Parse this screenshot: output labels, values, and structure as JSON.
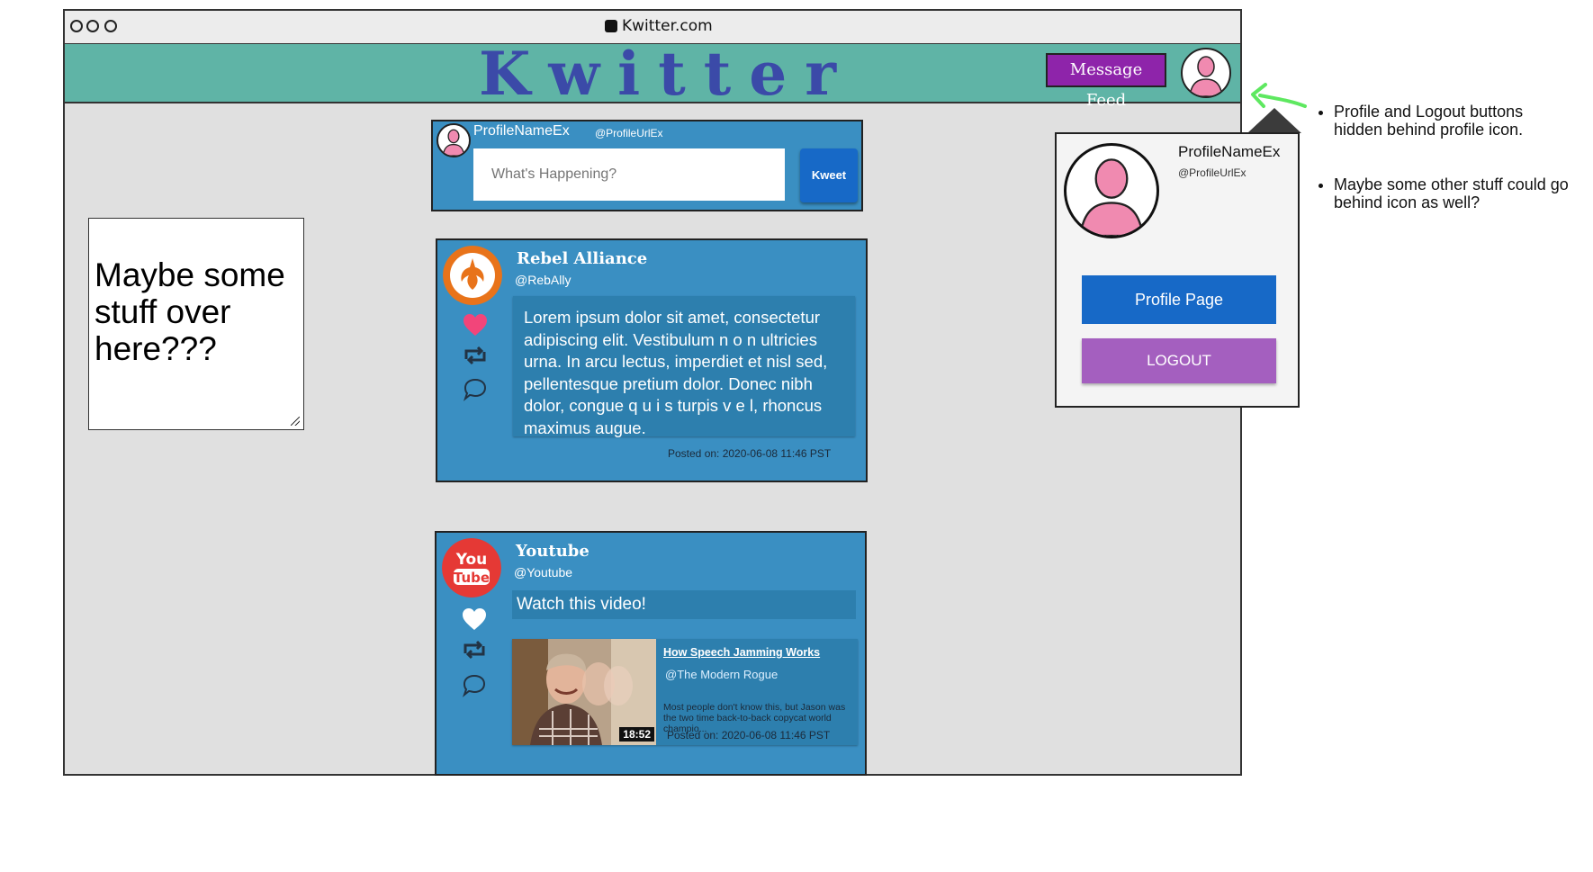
{
  "browser": {
    "url": "Kwitter.com"
  },
  "header": {
    "logo": "Kwitter",
    "message_feed_label": "Message Feed"
  },
  "compose": {
    "profile_name": "ProfileNameEx",
    "profile_url": "@ProfileUrlEx",
    "placeholder": "What's Happening?",
    "submit_label": "Kweet"
  },
  "side_note": {
    "text": "Maybe some stuff over here???"
  },
  "posts": [
    {
      "author": "Rebel Alliance",
      "handle": "@RebAlly",
      "body": "Lorem ipsum dolor sit amet, consectetur adipiscing elit. Vestibulum n o n ultricies urna. In arcu lectus, imperdiet et nisl sed, pellentesque pretium dolor. Donec nibh dolor, congue q u i s turpis v e l, rhoncus maximus augue.",
      "posted": "Posted on: 2020-06-08 11:46 PST",
      "liked": true
    },
    {
      "author": "Youtube",
      "handle": "@Youtube",
      "body": "Watch this video!",
      "posted": "Posted on: 2020-06-08 11:46 PST",
      "liked": false,
      "video": {
        "title": "How Speech Jamming Works",
        "channel": "@The Modern Rogue",
        "description": "Most people don't know this, but Jason was the two time back-to-back copycat world champio...",
        "duration": "18:52"
      },
      "logo_text_top": "You",
      "logo_text_bottom": "Tube"
    }
  ],
  "profile_dropdown": {
    "name": "ProfileNameEx",
    "url": "@ProfileUrlEx",
    "profile_button": "Profile Page",
    "logout_button": "LOGOUT"
  },
  "annotations": [
    "Profile and Logout buttons hidden behind profile icon.",
    "Maybe some other stuff could go behind icon as well?"
  ],
  "colors": {
    "header_bg": "#5fb4a6",
    "logo": "#3b4aa8",
    "post_bg": "#3a8fc2",
    "accent_purple": "#8e24aa",
    "primary_blue": "#1769c7",
    "like_pink": "#f2457a"
  },
  "icons": [
    "twitter-bird-icon",
    "user-avatar-icon",
    "rebel-alliance-icon",
    "youtube-icon",
    "heart-icon",
    "retweet-icon",
    "comment-icon",
    "green-arrow-icon"
  ]
}
